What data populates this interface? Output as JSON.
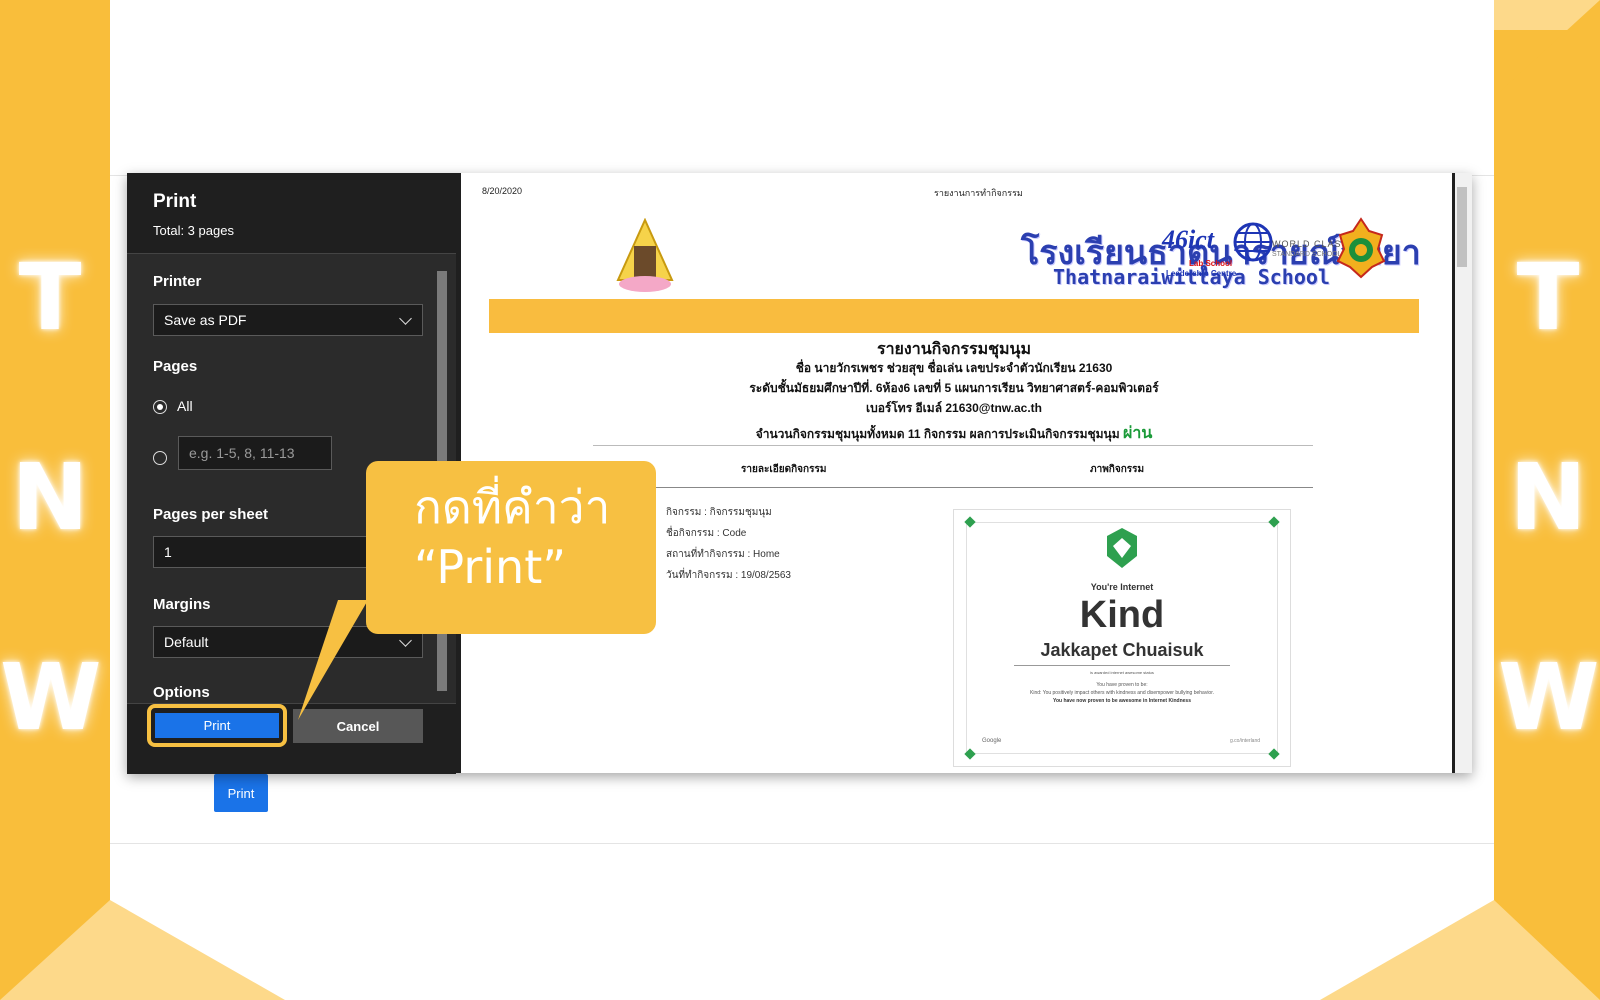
{
  "side_letters": [
    "T",
    "N",
    "W"
  ],
  "colors": {
    "frame": "#F9BE3B",
    "accent_blue": "#1A73E8",
    "dialog_dark": "#2B2B2B",
    "pass_green": "#1A9A38"
  },
  "background_print_button": "Print",
  "dialog": {
    "title": "Print",
    "subtitle": "Total: 3 pages",
    "printer": {
      "label": "Printer",
      "value": "Save as PDF"
    },
    "pages": {
      "label": "Pages",
      "all_label": "All",
      "custom_placeholder": "e.g. 1-5, 8, 11-13"
    },
    "pages_per_sheet": {
      "label": "Pages per sheet",
      "value": "1"
    },
    "margins": {
      "label": "Margins",
      "value": "Default"
    },
    "options_label": "Options",
    "print_button": "Print",
    "cancel_button": "Cancel"
  },
  "preview": {
    "date": "8/20/2020",
    "header_title": "รายงานการทำกิจกรรม",
    "school_th": "โรงเรียนธาตุนารายณ์วิทยา",
    "school_en": "Thatnaraiwittaya School",
    "logo_46ict": "46ict",
    "logo_46ict_sub1": "Lab School",
    "logo_46ict_sub2": "Leadership Centre",
    "logo_world": "WORLD CLASS",
    "logo_world_sub": "STANDARD SCHOOL",
    "report_title": "รายงานกิจกรรมชุมนุม",
    "line1": "ชื่อ นายวักรเพชร ช่วยสุข ชื่อเล่น เลขประจำตัวนักเรียน 21630",
    "line2": "ระดับชั้นมัธยมศึกษาปีที่. 6ห้อง6 เลขที่ 5 แผนการเรียน วิทยาศาสตร์-คอมพิวเตอร์",
    "line3": "เบอร์โทร อีเมล์ 21630@tnw.ac.th",
    "line4_prefix": "จำนวนกิจกรรมชุมนุมทั้งหมด 11 กิจกรรม ผลการประเมินกิจกรรมชุมนุม",
    "line4_result": "ผ่าน",
    "col_detail": "รายละเอียดกิจกรรม",
    "col_photo": "ภาพกิจกรรม",
    "details": [
      "กิจกรรม : กิจกรรมชุมนุม",
      "ชื่อกิจกรรม : Code",
      "สถานที่ทำกิจกรรม : Home",
      "วันที่ทำกิจกรรม : 19/08/2563"
    ],
    "certificate": {
      "eyebrow": "You're Internet",
      "headline": "Kind",
      "name": "Jakkapet Chuaisuk",
      "awarded": "is awarded internet awesome status",
      "body1": "You have proven to be:",
      "body2": "Kind: You positively impact others with kindness and disempower bullying behavior.",
      "body3": "You have now proven to be awesome in Internet Kindness",
      "google": "Google",
      "brand": "g.co/interland"
    }
  },
  "callout": {
    "line1": "กดที่คำว่า",
    "line2": "“Print”"
  }
}
